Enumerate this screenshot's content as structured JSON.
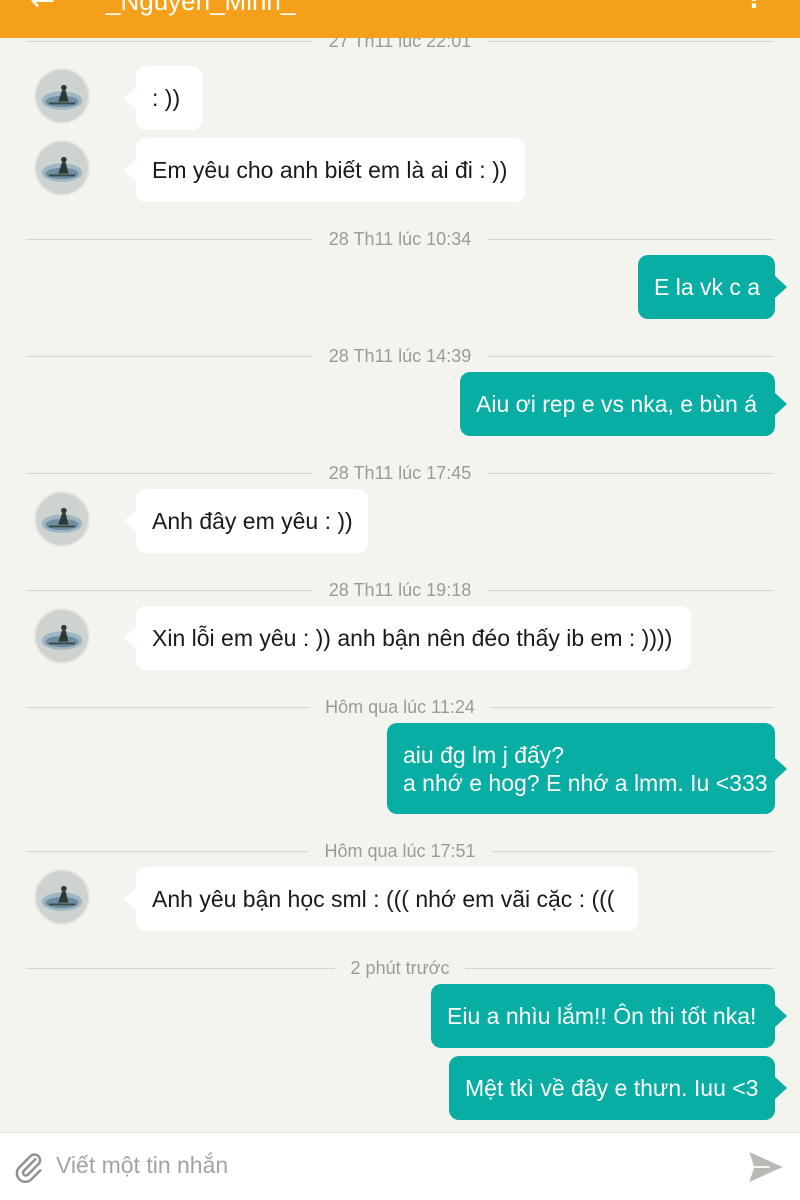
{
  "header": {
    "back_icon": "←",
    "contact_name": "_Nguyen_Minh_",
    "menu_icon": "⋮",
    "color": "#f5a01a"
  },
  "messages": [
    {
      "type": "separator",
      "text": "27 Th11 lúc 22:01"
    },
    {
      "type": "in",
      "lines": [
        ": ))"
      ]
    },
    {
      "type": "in",
      "lines": [
        "Em yêu cho anh biết em là ai đi : ))"
      ]
    },
    {
      "type": "separator",
      "text": "28 Th11 lúc 10:34"
    },
    {
      "type": "out",
      "lines": [
        "E la vk c a"
      ]
    },
    {
      "type": "separator",
      "text": "28 Th11 lúc 14:39"
    },
    {
      "type": "out",
      "lines": [
        "Aiu ơi rep e vs nka, e bùn á"
      ]
    },
    {
      "type": "separator",
      "text": "28 Th11 lúc 17:45"
    },
    {
      "type": "in",
      "lines": [
        "Anh đây em yêu : ))"
      ]
    },
    {
      "type": "separator",
      "text": "28 Th11 lúc 19:18"
    },
    {
      "type": "in",
      "lines": [
        "Xin lỗi em yêu : )) anh bận nên đéo thấy ib em : ))))"
      ]
    },
    {
      "type": "separator",
      "text": "Hôm qua lúc 11:24"
    },
    {
      "type": "out",
      "lines": [
        "aiu đg lm j đấy?",
        "a nhớ e hog? E nhớ a lmm. Iu <333"
      ]
    },
    {
      "type": "separator",
      "text": "Hôm qua lúc 17:51"
    },
    {
      "type": "in",
      "lines": [
        "Anh yêu bận học sml : ((( nhớ em vãi cặc : ((("
      ]
    },
    {
      "type": "separator",
      "text": "2 phút trước"
    },
    {
      "type": "out",
      "lines": [
        "Eiu a nhìu lắm!! Ôn thi tốt nka!"
      ]
    },
    {
      "type": "out",
      "lines": [
        "Mệt tkì về đây e thưn. Iuu <3"
      ]
    }
  ],
  "input": {
    "placeholder": "Viết một tin nhắn",
    "attach_icon": "paperclip-icon",
    "send_icon": "send-icon"
  },
  "colors": {
    "outgoing_bubble": "#08aea4",
    "incoming_bubble": "#ffffff",
    "background": "#f4f4ee"
  }
}
